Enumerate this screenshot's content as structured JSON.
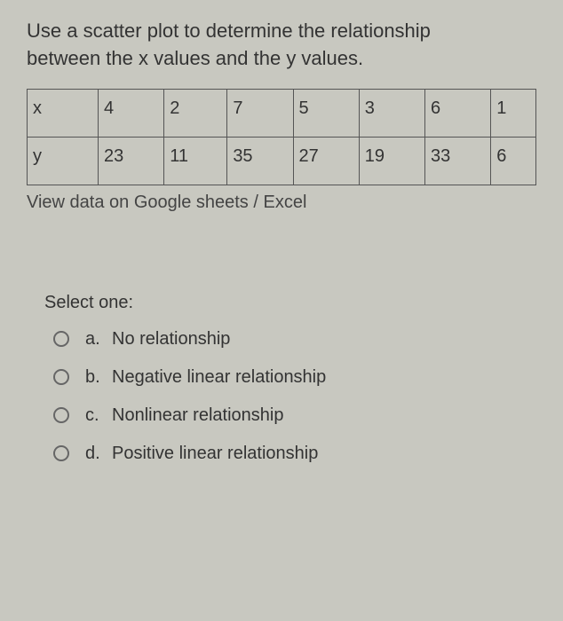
{
  "question": {
    "line1": "Use a scatter plot to determine the relationship",
    "line2": "between the x values and the y values."
  },
  "table": {
    "row1_label": "x",
    "row1": [
      "4",
      "2",
      "7",
      "5",
      "3",
      "6",
      "1"
    ],
    "row2_label": "y",
    "row2": [
      "23",
      "11",
      "35",
      "27",
      "19",
      "33",
      "6"
    ]
  },
  "link_text": "View data on Google sheets / Excel",
  "select_prompt": "Select one:",
  "options": [
    {
      "letter": "a.",
      "text": "No relationship"
    },
    {
      "letter": "b.",
      "text": "Negative linear relationship"
    },
    {
      "letter": "c.",
      "text": "Nonlinear relationship"
    },
    {
      "letter": "d.",
      "text": "Positive linear relationship"
    }
  ],
  "chart_data": {
    "type": "table",
    "title": "Scatter plot data: x vs y",
    "columns": [
      "x",
      "y"
    ],
    "rows": [
      [
        4,
        23
      ],
      [
        2,
        11
      ],
      [
        7,
        35
      ],
      [
        5,
        27
      ],
      [
        3,
        19
      ],
      [
        6,
        33
      ],
      [
        1,
        6
      ]
    ]
  }
}
